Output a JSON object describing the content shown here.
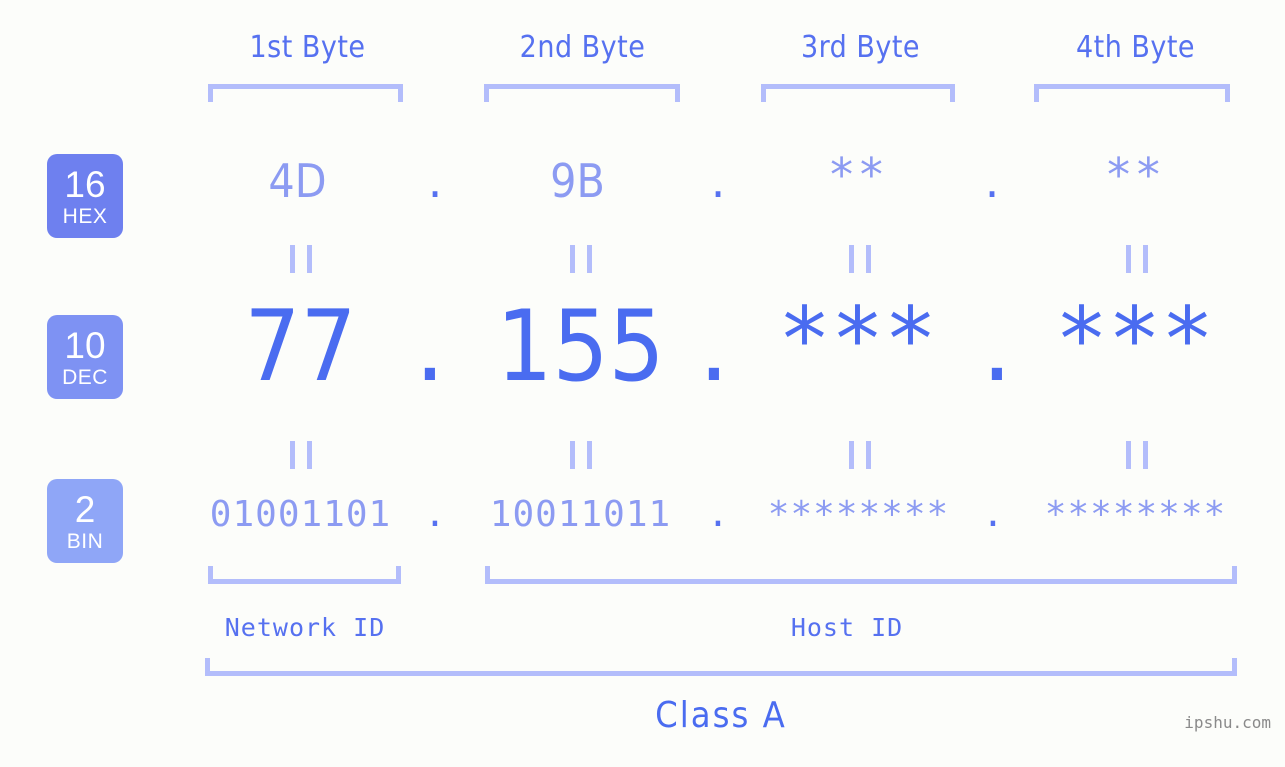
{
  "page": {
    "background_color": "#fcfdfa",
    "accent_strong": "#4a6cf0",
    "accent_mid": "#5671f0",
    "accent_light": "#8c9bf2",
    "bracket_color": "#b3bdfb",
    "watermark": "ipshu.com"
  },
  "byte_headers": [
    {
      "label": "1st Byte"
    },
    {
      "label": "2nd Byte"
    },
    {
      "label": "3rd Byte"
    },
    {
      "label": "4th Byte"
    }
  ],
  "radix_badges": [
    {
      "number": "16",
      "name": "HEX",
      "color": "#6e80ef"
    },
    {
      "number": "10",
      "name": "DEC",
      "color": "#7e92f3"
    },
    {
      "number": "2",
      "name": "BIN",
      "color": "#8fa6f7"
    }
  ],
  "rows": {
    "hex": {
      "radix": "16",
      "values": [
        "4D",
        "9B",
        "**",
        "**"
      ],
      "separator": "."
    },
    "dec": {
      "radix": "10",
      "values": [
        "77",
        "155",
        "***",
        "***"
      ],
      "separator": "."
    },
    "bin": {
      "radix": "2",
      "values": [
        "01001101",
        "10011011",
        "********",
        "********"
      ],
      "separator": "."
    }
  },
  "equality_marks": {
    "glyph": "||",
    "count_per_row": 4
  },
  "sections": [
    {
      "label": "Network ID"
    },
    {
      "label": "Host ID"
    }
  ],
  "class": {
    "label": "Class A"
  }
}
